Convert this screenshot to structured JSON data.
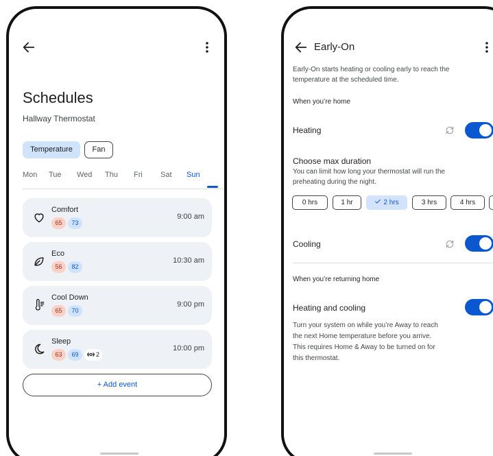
{
  "schedules": {
    "title": "Schedules",
    "subtitle": "Hallway Thermostat",
    "mode_chips": [
      "Temperature",
      "Fan"
    ],
    "selected_chip": "Temperature",
    "days": [
      "Mon",
      "Tue",
      "Wed",
      "Thu",
      "Fri",
      "Sat",
      "Sun"
    ],
    "selected_day": "Sun",
    "events": [
      {
        "name": "Comfort",
        "heat": "65",
        "cool": "73",
        "time": "9:00 am",
        "icon": "heart-icon"
      },
      {
        "name": "Eco",
        "heat": "56",
        "cool": "82",
        "time": "10:30 am",
        "icon": "leaf-icon"
      },
      {
        "name": "Cool Down",
        "heat": "65",
        "cool": "70",
        "time": "9:00 pm",
        "icon": "thermometer-icon"
      },
      {
        "name": "Sleep",
        "heat": "63",
        "cool": "69",
        "fan": "2",
        "time": "10:00 pm",
        "icon": "moon-icon"
      }
    ],
    "add_event_label": "+ Add event"
  },
  "early_on": {
    "title": "Early-On",
    "description": [
      "Early-On starts heating or cooling early to reach the",
      "temperature at the scheduled time."
    ],
    "when_home": "When you’re home",
    "heating_label": "Heating",
    "heating_on": true,
    "max_duration_title": "Choose max duration",
    "max_duration_desc": [
      "You can limit how long your thermostat will run the",
      "preheating during the night."
    ],
    "durations": [
      "0 hrs",
      "1 hr",
      "2 hrs",
      "3 hrs",
      "4 hrs"
    ],
    "selected_duration": "2 hrs",
    "cooling_label": "Cooling",
    "cooling_on": true,
    "when_returning": "When you’re returning home",
    "heat_cool_label": "Heating and cooling",
    "heat_cool_on": true,
    "heat_cool_desc": [
      "Turn your system on while you’re Away to reach",
      "the next Home temperature before you arrive.",
      "This requires Home & Away to be turned on for",
      "this thermostat."
    ]
  },
  "colors": {
    "accent": "#0b57d0",
    "selected_chip_bg": "#cfe3fb",
    "card_bg": "#eef1f6",
    "heat_pill_bg": "#f9d2c6",
    "cool_pill_bg": "#d0e3fb"
  }
}
